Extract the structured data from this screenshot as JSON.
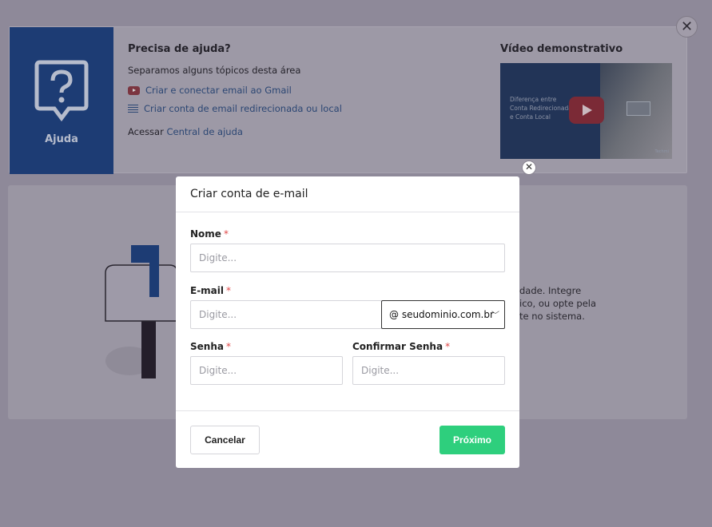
{
  "help": {
    "side_label": "Ajuda",
    "title": "Precisa de ajuda?",
    "subtitle": "Separamos alguns tópicos desta área",
    "links": [
      {
        "label": "Criar e conectar email ao Gmail",
        "icon": "youtube-icon"
      },
      {
        "label": "Criar conta de email redirecionada ou local",
        "icon": "list-icon"
      }
    ],
    "access_prefix": "Acessar",
    "access_link": "Central de ajuda",
    "video_title": "Vídeo demonstrativo",
    "video_caption": "Diferença entre Conta Redirecionada e Conta Local",
    "video_brand": "Techmi"
  },
  "background_content": {
    "text_lines": [
      "dade. Integre",
      "ico, ou opte pela",
      "te no sistema."
    ]
  },
  "modal": {
    "title": "Criar conta de e-mail",
    "name_label": "Nome",
    "name_placeholder": "Digite...",
    "email_label": "E-mail",
    "email_placeholder": "Digite...",
    "domain_selected": "@ seudominio.com.br",
    "password_label": "Senha",
    "password_placeholder": "Digite...",
    "confirm_label": "Confirmar Senha",
    "confirm_placeholder": "Digite...",
    "required_mark": "*",
    "cancel_label": "Cancelar",
    "next_label": "Próximo"
  },
  "colors": {
    "overlay": "#8e8999",
    "help_side": "#1d3c74",
    "primary_button": "#2ecf7d",
    "required": "#e04848"
  }
}
